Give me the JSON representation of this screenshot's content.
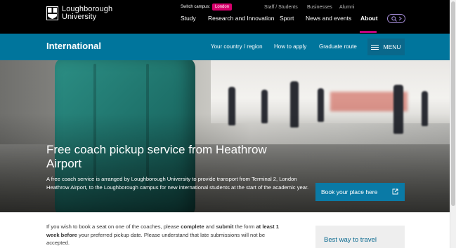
{
  "header": {
    "logo_line1": "Loughborough",
    "logo_line2": "University",
    "switch_label": "Switch campus:",
    "switch_campus": "London",
    "utility_links": [
      "Staff / Students",
      "Businesses",
      "Alumni"
    ],
    "main_nav": [
      "Study",
      "Research and Innovation",
      "Sport",
      "News and events",
      "About"
    ],
    "active_nav": "About",
    "search_icon": "search-arrow-icon"
  },
  "subnav": {
    "title": "International",
    "links": [
      "Your country / region",
      "How to apply",
      "Graduate route"
    ],
    "menu_label": "MENU"
  },
  "hero": {
    "title": "Free coach pickup service from Heathrow Airport",
    "description": "A free coach service is arranged by Loughborough University to provide transport from Terminal 2, London Heathrow Airport, to the Loughborough campus for new international students at the start of the academic year.",
    "cta_label": "Book your place here",
    "cta_icon": "external-link-icon"
  },
  "content": {
    "p1_a": "If you wish to book a seat on one of the coaches, please ",
    "p1_b": "complete",
    "p1_c": " and ",
    "p1_d": "submit",
    "p1_e": " the form ",
    "p1_f": "at least 1 week before",
    "p1_g": " your preferred pickup date. Please understand that late submissions will not be accepted."
  },
  "sidebar": {
    "title": "Best way to travel"
  },
  "colors": {
    "top_bar": "#000000",
    "international_bar": "#00759c",
    "accent_pink": "#d6006c",
    "cta": "#0a7aa6"
  }
}
